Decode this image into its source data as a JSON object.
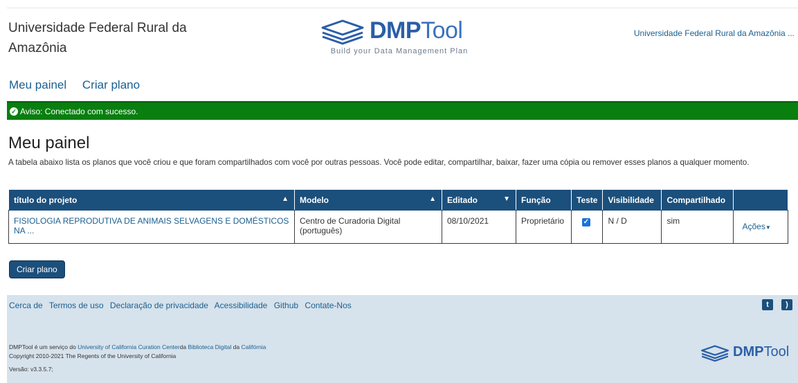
{
  "header": {
    "org_name": "Universidade Federal Rural da Amazônia",
    "logo": {
      "brand_bold": "DMP",
      "brand_light": "Tool",
      "tagline": "Build your Data Management Plan"
    },
    "org_link": "Universidade Federal Rural da Amazônia ..."
  },
  "nav": {
    "items": [
      {
        "label": "Meu painel"
      },
      {
        "label": "Criar plano"
      }
    ]
  },
  "notice": {
    "text": "Aviso: Conectado com sucesso.",
    "icon": "check-circle-icon"
  },
  "main": {
    "title": "Meu painel",
    "description": "A tabela abaixo lista os planos que você criou e que foram compartilhados com você por outras pessoas. Você pode editar, compartilhar, baixar, fazer uma cópia ou remover esses planos a qualquer momento.",
    "table": {
      "headers": {
        "title": "título do projeto",
        "model": "Modelo",
        "edited": "Editado",
        "role": "Função",
        "test": "Teste",
        "visibility": "Visibilidade",
        "shared": "Compartilhado"
      },
      "rows": [
        {
          "title": "FISIOLOGIA REPRODUTIVA DE ANIMAIS SELVAGENS E DOMÉSTICOS NA ...",
          "model": "Centro de Curadoria Digital (português)",
          "edited": "08/10/2021",
          "role": "Proprietário",
          "test_checked": true,
          "visibility": "N / D",
          "shared": "sim",
          "actions": "Ações"
        }
      ]
    },
    "create_button": "Criar plano"
  },
  "footer": {
    "links": [
      {
        "label": "Cerca de"
      },
      {
        "label": "Termos de uso"
      },
      {
        "label": "Declaração de privacidade"
      },
      {
        "label": "Acessibilidade"
      },
      {
        "label": "Github"
      },
      {
        "label": "Contate-Nos"
      }
    ],
    "social_icons": [
      "twitter-icon",
      "rss-icon"
    ],
    "service_prefix": "DMPTool é um serviço do ",
    "service_link1": "University of California Curation Center",
    "service_mid": "da ",
    "service_link2": "Biblioteca Digital",
    "service_mid2": " da ",
    "service_link3": "Califórnia",
    "copyright": "Copyright 2010-2021 The Regents of the University of California",
    "version": "Versão: v3.3.5.7;",
    "logo": {
      "brand_bold": "DMP",
      "brand_light": "Tool"
    }
  },
  "colors": {
    "primary": "#1b4f7c",
    "link": "#1a5f8f",
    "success": "#087f0f",
    "footer_bg": "#d6e2ec"
  }
}
